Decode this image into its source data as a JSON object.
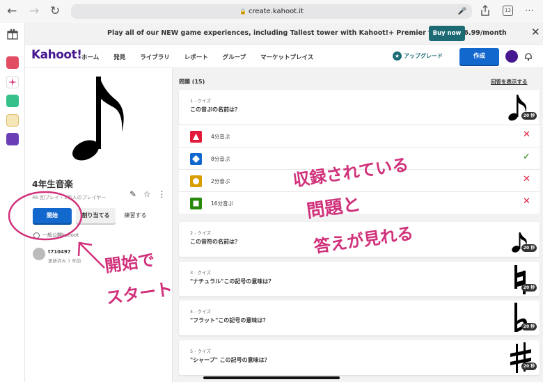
{
  "browser": {
    "url": "create.kahoot.it",
    "tab_count": "13"
  },
  "promo": {
    "text": "Play all of our NEW game experiences, including Tallest tower with Kahoot!+ Premier for only $6.99/month",
    "button": "Buy now"
  },
  "header": {
    "logo": "Kahoot!",
    "nav": [
      "ホーム",
      "発見",
      "ライブラリ",
      "レポート",
      "グループ",
      "マーケットプレイス"
    ],
    "upgrade": "アップグレード",
    "create": "作成"
  },
  "kahoot": {
    "title": "4年生音楽",
    "meta": "46 回プレイ・1万人のプレイヤー",
    "start": "開始",
    "assign": "割り当てる",
    "practice": "練習する",
    "visibility": "一般公開kahoot",
    "owner": "t710497",
    "owner_sub": "更新済み 1 年前"
  },
  "questions": {
    "header": "問題 (15)",
    "show_answers": "回答を表示する",
    "items": [
      {
        "type": "1 - クイズ",
        "text": "この音ぷの名前は？",
        "time": "20 秒",
        "answers": [
          {
            "text": "4分音ぷ",
            "correct": false
          },
          {
            "text": "8分音ぷ",
            "correct": true
          },
          {
            "text": "2分音ぷ",
            "correct": false
          },
          {
            "text": "16分音ぷ",
            "correct": false
          }
        ]
      },
      {
        "type": "2 - クイズ",
        "text": "この音符の名前は？",
        "time": "20 秒"
      },
      {
        "type": "3 - クイズ",
        "text": "\"ナチュラル\"この記号の意味は？",
        "time": "20 秒"
      },
      {
        "type": "4 - クイズ",
        "text": "\"フラット\"この記号の意味は？",
        "time": "20 秒"
      },
      {
        "type": "5 - クイズ",
        "text": "\"シャープ\" この記号の意味は？",
        "time": "20 秒"
      }
    ]
  },
  "annotations": {
    "a1": "収録されている",
    "a2": "問題と",
    "a3": "答えが見れる",
    "b1": "開始で",
    "b2": "スタート"
  },
  "colors": {
    "red": "#e21b3c",
    "blue": "#1368ce",
    "yellow": "#d89e00",
    "green": "#26890c",
    "purple": "#46178f",
    "annotation": "#d0317a"
  }
}
